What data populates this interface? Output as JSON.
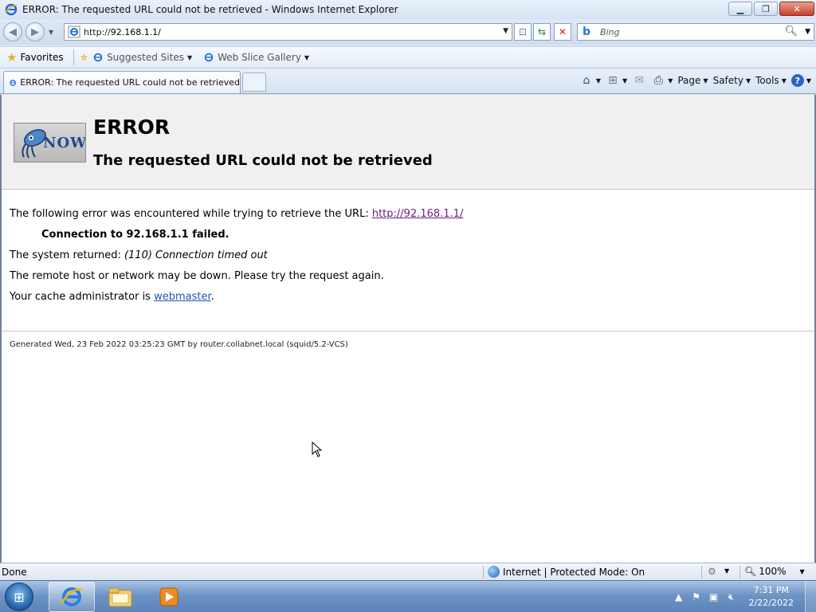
{
  "window": {
    "title": "ERROR: The requested URL could not be retrieved - Windows Internet Explorer",
    "minimize": "▁",
    "maximize": "❐",
    "close": "✕"
  },
  "address_bar": {
    "url_prefix": "http://",
    "url_host": "92.168.1.1/",
    "search_placeholder": "Bing"
  },
  "favorites_bar": {
    "favorites_label": "Favorites",
    "items": [
      {
        "label": "Suggested Sites"
      },
      {
        "label": "Web Slice Gallery"
      }
    ]
  },
  "tabs": [
    {
      "label": "ERROR: The requested URL could not be retrieved"
    }
  ],
  "command_bar": {
    "page_label": "Page",
    "safety_label": "Safety",
    "tools_label": "Tools"
  },
  "page": {
    "logo_text": "NOW",
    "heading": "ERROR",
    "subheading": "The requested URL could not be retrieved",
    "line1_text": "The following error was encountered while trying to retrieve the URL: ",
    "line1_link": "http://92.168.1.1/",
    "line2": "Connection to 92.168.1.1 failed.",
    "line3_prefix": "The system returned: ",
    "line3_italic": "(110) Connection timed out",
    "line4": "The remote host or network may be down. Please try the request again.",
    "line5_prefix": "Your cache administrator is ",
    "line5_link": "webmaster",
    "line5_suffix": ".",
    "footer": "Generated Wed, 23 Feb 2022 03:25:23 GMT by router.collabnet.local (squid/5.2-VCS)"
  },
  "status_bar": {
    "status": "Done",
    "zone": "Internet | Protected Mode: On",
    "zoom": "100%"
  },
  "taskbar": {
    "time": "7:31 PM",
    "date": "2/22/2022"
  },
  "colors": {
    "visited_link": "#6a1f7a",
    "link": "#1c54b8",
    "content_header_bg": "#f0f0f0"
  }
}
